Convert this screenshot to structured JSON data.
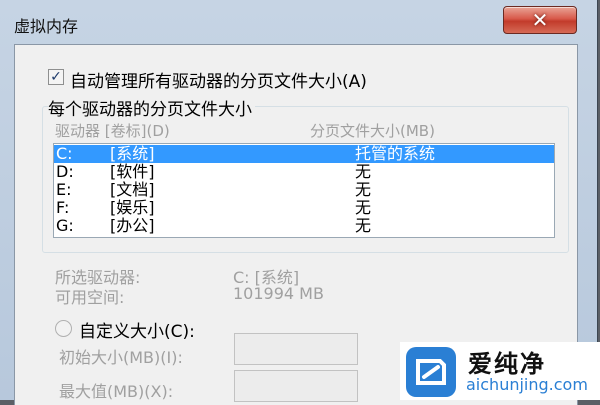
{
  "window": {
    "title": "虚拟内存",
    "close_icon": "close-icon",
    "close_color": "#c23b2b"
  },
  "auto_manage": {
    "label": "自动管理所有驱动器的分页文件大小(A)",
    "checked": true
  },
  "drives_group": {
    "label": "每个驱动器的分页文件大小",
    "columns": [
      "驱动器 [卷标](D)",
      "分页文件大小(MB)"
    ],
    "rows": [
      {
        "drive": "C:",
        "label": "[系统]",
        "size": "托管的系统",
        "selected": true
      },
      {
        "drive": "D:",
        "label": "[软件]",
        "size": "无",
        "selected": false
      },
      {
        "drive": "E:",
        "label": "[文档]",
        "size": "无",
        "selected": false
      },
      {
        "drive": "F:",
        "label": "[娱乐]",
        "size": "无",
        "selected": false
      },
      {
        "drive": "G:",
        "label": "[办公]",
        "size": "无",
        "selected": false
      }
    ]
  },
  "selected_drive": {
    "label": "所选驱动器:",
    "value": "C:  [系统]",
    "space_label": "可用空间:",
    "space_value": "101994 MB"
  },
  "custom_size": {
    "label": "自定义大小(C):",
    "initial_label": "初始大小(MB)(I):",
    "max_label": "最大值(MB)(X):",
    "initial_value": "",
    "max_value": ""
  },
  "watermark": {
    "title": "爱纯净",
    "url": "aichunjing.com",
    "accent": "#2a7fd4"
  },
  "colors": {
    "selection": "#3399ff",
    "disabled_text": "#a0a0a0"
  }
}
